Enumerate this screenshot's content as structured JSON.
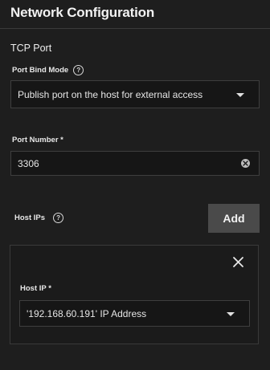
{
  "header": {
    "title": "Network Configuration"
  },
  "tcp": {
    "section_label": "TCP Port",
    "port_bind_mode": {
      "label": "Port Bind Mode",
      "help_icon": "help-circle-icon",
      "value": "Publish port on the host for external access",
      "caret_icon": "caret-down-icon"
    },
    "port_number": {
      "label": "Port Number *",
      "value": "3306",
      "clear_icon": "clear-circle-icon"
    }
  },
  "host_ips": {
    "label": "Host IPs",
    "help_icon": "help-circle-icon",
    "add_label": "Add",
    "items": [
      {
        "label": "Host IP *",
        "value": "'192.168.60.191' IP Address",
        "close_icon": "close-icon",
        "caret_icon": "caret-down-icon"
      }
    ]
  },
  "colors": {
    "background": "#1e1e1e",
    "field_background": "#161616",
    "border": "#3e3e3e",
    "button": "#4a4a4a",
    "text": "#e6e6e6"
  }
}
